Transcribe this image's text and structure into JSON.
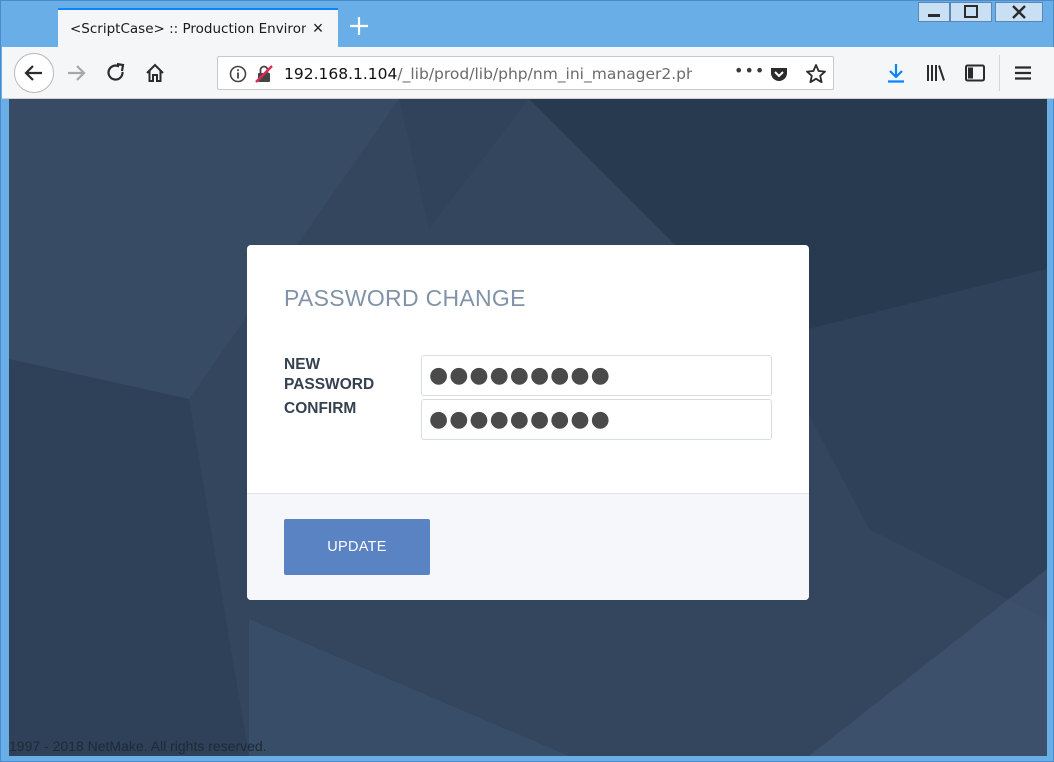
{
  "browser": {
    "tab_title": "<ScriptCase> :: Production Environm",
    "url_host": "192.168.1.104",
    "url_path": "/_lib/prod/lib/php/nm_ini_manager2.ph",
    "accent_color": "#0a84ff"
  },
  "icons": {
    "tab_close": "×",
    "new_tab": "+",
    "back": "←",
    "forward": "→",
    "reload": "reload-icon",
    "home": "home-icon",
    "info": "info-icon",
    "insecure": "insecure-lock-icon",
    "more": "•••",
    "pocket": "pocket-icon",
    "bookmark": "star-icon",
    "download": "download-icon",
    "library": "library-icon",
    "sidebar": "sidebar-icon",
    "menu": "hamburger-icon"
  },
  "form": {
    "title": "PASSWORD CHANGE",
    "new_password_label": "NEW PASSWORD",
    "confirm_label": "CONFIRM",
    "new_password_value": "●●●●●●●●●",
    "confirm_value": "●●●●●●●●●",
    "update_label": "UPDATE",
    "button_color": "#5a83c4"
  },
  "footer": {
    "text": "1997 - 2018 NetMake. All rights reserved."
  }
}
